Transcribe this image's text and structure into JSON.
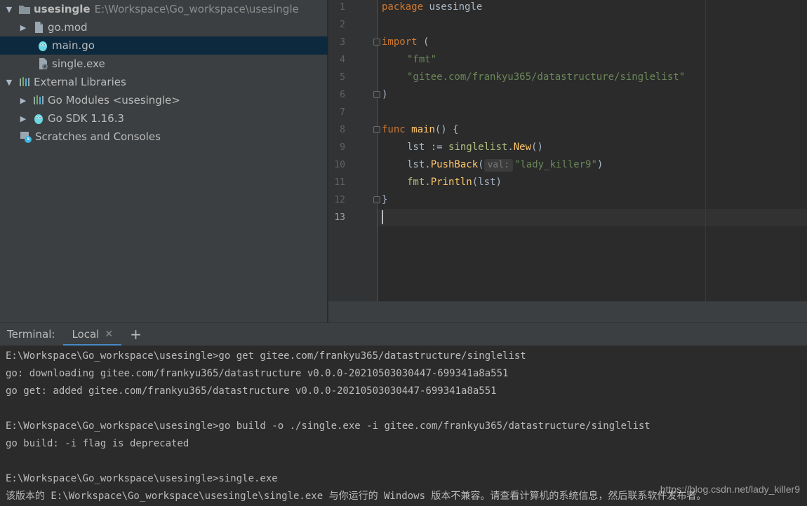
{
  "project_tree": {
    "root": {
      "label": "usesingle",
      "path": "E:\\Workspace\\Go_workspace\\usesingle"
    },
    "items": [
      {
        "label": "go.mod"
      },
      {
        "label": "main.go"
      },
      {
        "label": "single.exe"
      }
    ],
    "external_libraries": "External Libraries",
    "go_modules": "Go Modules <usesingle>",
    "go_sdk": "Go SDK 1.16.3",
    "scratches": "Scratches and Consoles"
  },
  "editor": {
    "line_numbers": [
      "1",
      "2",
      "3",
      "4",
      "5",
      "6",
      "7",
      "8",
      "9",
      "10",
      "11",
      "12",
      "13"
    ],
    "lines": {
      "l1_kw": "package",
      "l1_rest": " usesingle",
      "l3_kw": "import",
      "l3_rest": " (",
      "l4": "\"fmt\"",
      "l5": "\"gitee.com/frankyu365/datastructure/singlelist\"",
      "l6": ")",
      "l8_kw": "func",
      "l8_fn": "main",
      "l8_rest": "() {",
      "l9_a": "lst := ",
      "l9_pkg": "singlelist",
      "l9_dot": ".",
      "l9_fn": "New",
      "l9_end": "()",
      "l10_a": "lst.",
      "l10_fn": "PushBack",
      "l10_open": "(",
      "l10_hint": "val:",
      "l10_str": "\"lady_killer9\"",
      "l10_close": ")",
      "l11_pkg": "fmt",
      "l11_dot": ".",
      "l11_fn": "Println",
      "l11_end": "(lst)",
      "l12": "}"
    }
  },
  "terminal": {
    "title": "Terminal:",
    "tab_label": "Local",
    "lines": [
      "E:\\Workspace\\Go_workspace\\usesingle>go get gitee.com/frankyu365/datastructure/singlelist",
      "go: downloading gitee.com/frankyu365/datastructure v0.0.0-20210503030447-699341a8a551",
      "go get: added gitee.com/frankyu365/datastructure v0.0.0-20210503030447-699341a8a551",
      "",
      "E:\\Workspace\\Go_workspace\\usesingle>go build -o ./single.exe -i gitee.com/frankyu365/datastructure/singlelist",
      "go build: -i flag is deprecated",
      "",
      "E:\\Workspace\\Go_workspace\\usesingle>single.exe",
      "该版本的 E:\\Workspace\\Go_workspace\\usesingle\\single.exe 与你运行的 Windows 版本不兼容。请查看计算机的系统信息，然后联系软件发布者。"
    ]
  },
  "watermark": "https://blog.csdn.net/lady_killer9"
}
